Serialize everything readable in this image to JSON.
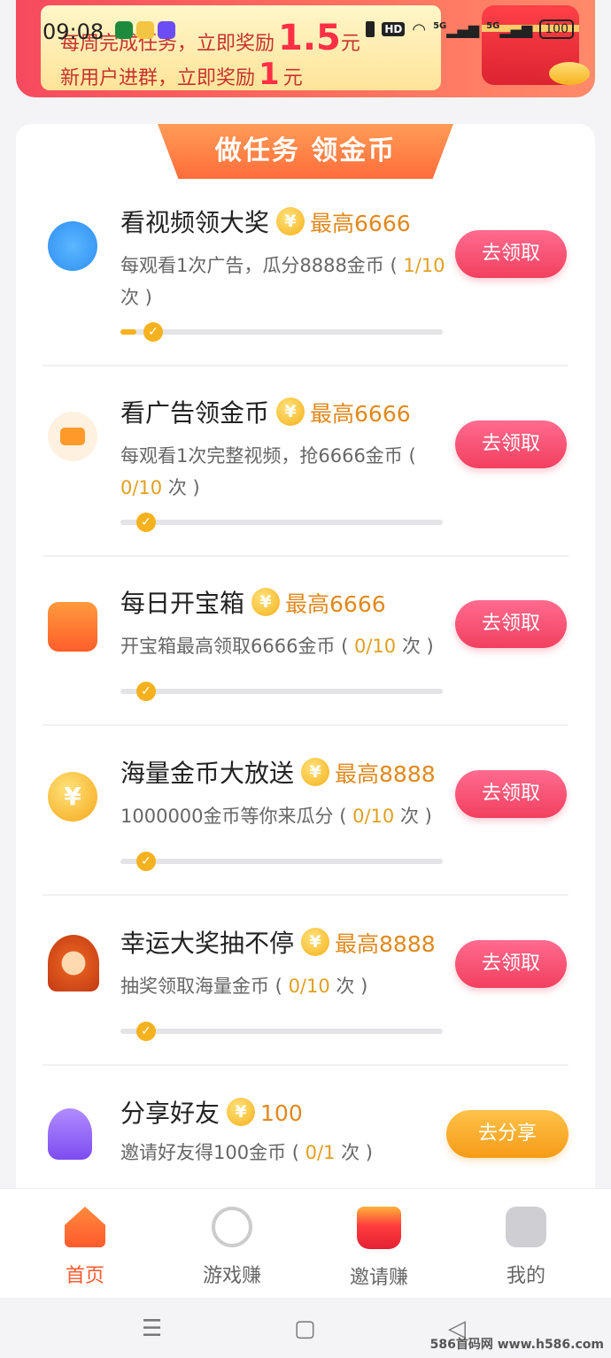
{
  "status_bar": {
    "time": "09:08",
    "hd": "HD",
    "network_1": "5G",
    "network_2": "5G",
    "battery": "100"
  },
  "banner": {
    "line1_text": "每周完成任务，立即奖励",
    "line1_amount": "1.5",
    "line1_unit": "元",
    "line2_text": "新用户进群，立即奖励",
    "line2_amount": "1",
    "line2_unit": "元"
  },
  "panel": {
    "title": "做任务 领金币",
    "coin_symbol": "¥",
    "tasks": [
      {
        "title": "看视频领大奖",
        "max": "最高6666",
        "desc_prefix": "每观看1次广告，瓜分8888金币 (",
        "progress": "1/10",
        "desc_suffix": "次 )",
        "button": "去领取",
        "fill": 0.05
      },
      {
        "title": "看广告领金币",
        "max": "最高6666",
        "desc_prefix": "每观看1次完整视频，抢6666金币 (",
        "progress": "0/10",
        "desc_suffix": "次 )",
        "button": "去领取",
        "fill": 0
      },
      {
        "title": "每日开宝箱",
        "max": "最高6666",
        "desc_prefix": "开宝箱最高领取6666金币 (",
        "progress": "0/10",
        "desc_suffix": "次 )",
        "button": "去领取",
        "fill": 0
      },
      {
        "title": "海量金币大放送",
        "max": "最高8888",
        "desc_prefix": "1000000金币等你来瓜分 (",
        "progress": "0/10",
        "desc_suffix": "次 )",
        "button": "去领取",
        "fill": 0
      },
      {
        "title": "幸运大奖抽不停",
        "max": "最高8888",
        "desc_prefix": "抽奖领取海量金币 (",
        "progress": "0/10",
        "desc_suffix": "次 )",
        "button": "去领取",
        "fill": 0
      },
      {
        "title": "分享好友",
        "max": "100",
        "desc_prefix": "邀请好友得100金币 (",
        "progress": "0/1",
        "desc_suffix": "次 )",
        "button": "去分享"
      }
    ]
  },
  "nav": {
    "items": [
      "首页",
      "游戏赚",
      "邀请赚",
      "我的"
    ],
    "active": "首页"
  },
  "watermark": "586首码网 www.h586.com",
  "colors": {
    "accent": "#ff5a2c",
    "button": "#f2405f",
    "coin": "#f5b21e"
  }
}
